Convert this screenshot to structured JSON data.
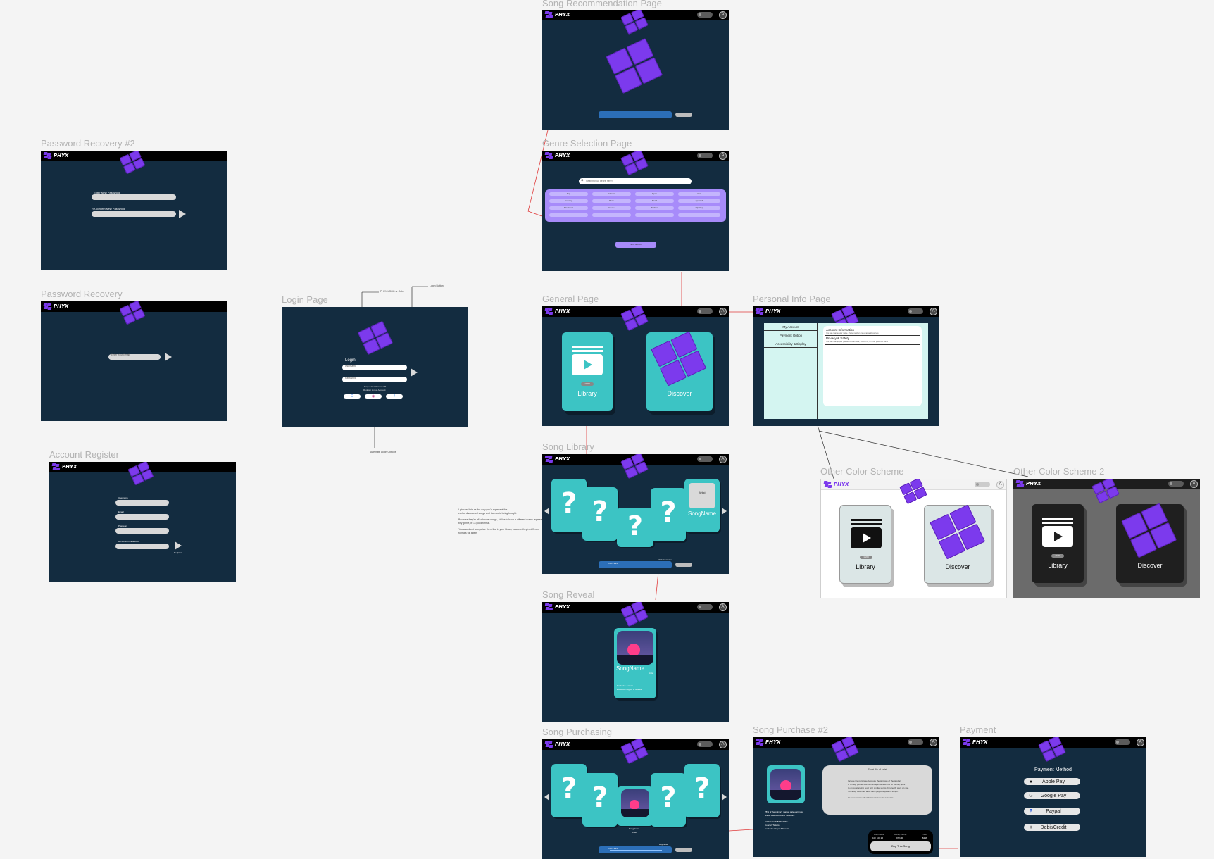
{
  "brand": "PHYX",
  "frames": {
    "song_recommendation": {
      "title": "Song Recommendation Page"
    },
    "password_recovery_2": {
      "title": "Password Recovery #2",
      "enter_label": "Enter New Password",
      "confirm_label": "Re-confirm New Password"
    },
    "genre_selection": {
      "title": "Genre Selection Page",
      "search_placeholder": "Search your genre here!",
      "genres": [
        "Pop",
        "Classic",
        "Kpop",
        "Jazz",
        "Country",
        "Rock",
        "Metal",
        "Spanish",
        "Electronic",
        "House",
        "Techno",
        "Hip Hop",
        "",
        "",
        "",
        ""
      ],
      "submit_label": "Next Section"
    },
    "password_recovery": {
      "title": "Password Recovery",
      "email_label": "Enter Your Email"
    },
    "login": {
      "title": "Login Page",
      "heading": "Login",
      "username_placeholder": "Username",
      "password_placeholder": "Password",
      "forgot": "Forgot Your Password?",
      "register": "Register A new Account",
      "annotation_logo": "PHYX LOGO or Cube",
      "annotation_button": "Login Button",
      "annotation_alt": "Alternate Login Options"
    },
    "general": {
      "title": "General Page",
      "library": "Library",
      "discover": "Discover",
      "library_badge": "10/20"
    },
    "personal_info": {
      "title": "Personal Info Page",
      "menu": [
        "My Account",
        "Payment Option",
        "Accessibility &Display"
      ],
      "sections": [
        {
          "heading": "Account Information",
          "desc": "You can change your name, phone number and email address here"
        },
        {
          "heading": "Privacy & Safety",
          "desc": "You can change your password, username, account id, or show preferred name"
        }
      ]
    },
    "account_register": {
      "title": "Account Register",
      "fields": [
        "Username",
        "Email",
        "Password",
        "Re-confirm Password"
      ],
      "register_label": "Register"
    },
    "song_library": {
      "title": "Song Library",
      "card_tag": "Artist",
      "song_name": "SongName",
      "time": "0:06 / 3:25",
      "like_label": "Mark Favourite",
      "share_label": "Share",
      "notes": [
        "I pictured this as the way you'd represent the",
        "earlier discovered songs and the music being bought.",
        "",
        "Because they're all unknown songs, I'd like to have a different scene representing",
        "tiny genre, it's a good format.",
        "",
        "You also don't categorize them like in your library because they're different",
        "formats for artists"
      ]
    },
    "other_color_scheme": {
      "title": "Other Color Scheme",
      "library": "Library",
      "discover": "Discover",
      "library_badge": "10/20"
    },
    "other_color_scheme_2": {
      "title": "Other Color Scheme 2",
      "library": "Library",
      "discover": "Discover",
      "library_badge": "10/20"
    },
    "song_reveal": {
      "title": "Song Reveal",
      "song_name": "SongName",
      "artist": "Artist",
      "features": [
        "Exclusive Access",
        "Exclusive Rights & Shares"
      ]
    },
    "song_purchasing": {
      "title": "Song Purchasing",
      "song_name": "SongName",
      "artist": "Artist",
      "time": "0:06 / 3:25",
      "buy_label": "Buy Now"
    },
    "song_purchase_2": {
      "title": "Song Purchase #2",
      "box_heading": "Short Bio of Artist",
      "box_lines": [
        "Include the purchase because the purpose of the product",
        "is to help people discover independent artists so money goes",
        "to an outstanding level with similar songs they really want on you.",
        "Not a big deal if an artist can't pay to appear in songs.",
        "",
        "Or be recommended their social media accounts."
      ],
      "note_lines": [
        "78% of the primary market sale earnings",
        "will be awarded to the musician.",
        "",
        "GIFT CHAIN BENEFITS:",
        "Concert Tickets",
        "Exclusive Drops & Events"
      ],
      "table_headers": [
        "Purchases",
        "Rarity Rating",
        "Price"
      ],
      "table_values": [
        "10 / 100 25",
        "97/100",
        "$398"
      ],
      "buy_label": "Buy This Song"
    },
    "payment": {
      "title": "Payment",
      "heading": "Payment Method",
      "methods": [
        "Apple Pay",
        "Google Pay",
        "Paypal",
        "Debit/Credit"
      ]
    }
  }
}
